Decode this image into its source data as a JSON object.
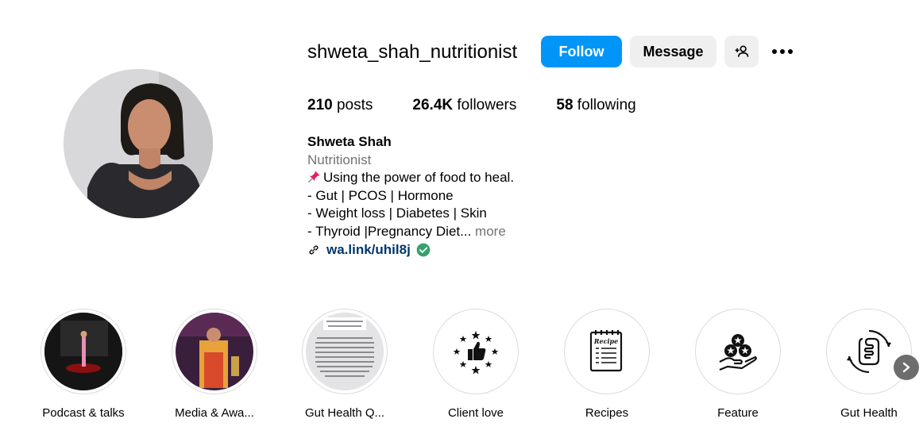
{
  "profile": {
    "username": "shweta_shah_nutritionist",
    "follow_label": "Follow",
    "message_label": "Message",
    "suggest_icon": "person-add-icon",
    "more_icon": "more-options-icon"
  },
  "stats": {
    "posts_count": "210",
    "posts_label": "posts",
    "followers_count": "26.4K",
    "followers_label": "followers",
    "following_count": "58",
    "following_label": "following"
  },
  "bio": {
    "name": "Shweta Shah",
    "category": "Nutritionist",
    "line1": "Using the power of food to heal.",
    "line2": "- Gut | PCOS | Hormone",
    "line3": "- Weight loss | Diabetes | Skin",
    "line4": "- Thyroid |Pregnancy Diet...",
    "more_label": "more",
    "link": "wa.link/uhil8j"
  },
  "highlights": [
    {
      "label": "Podcast & talks"
    },
    {
      "label": "Media & Awa..."
    },
    {
      "label": "Gut Health Q..."
    },
    {
      "label": "Client love"
    },
    {
      "label": "Recipes"
    },
    {
      "label": "Feature"
    },
    {
      "label": "Gut Health"
    }
  ],
  "colors": {
    "primary_button": "#0095f6",
    "secondary_button": "#efefef",
    "link": "#00376b",
    "muted_text": "#737373",
    "verified": "#36a269"
  }
}
